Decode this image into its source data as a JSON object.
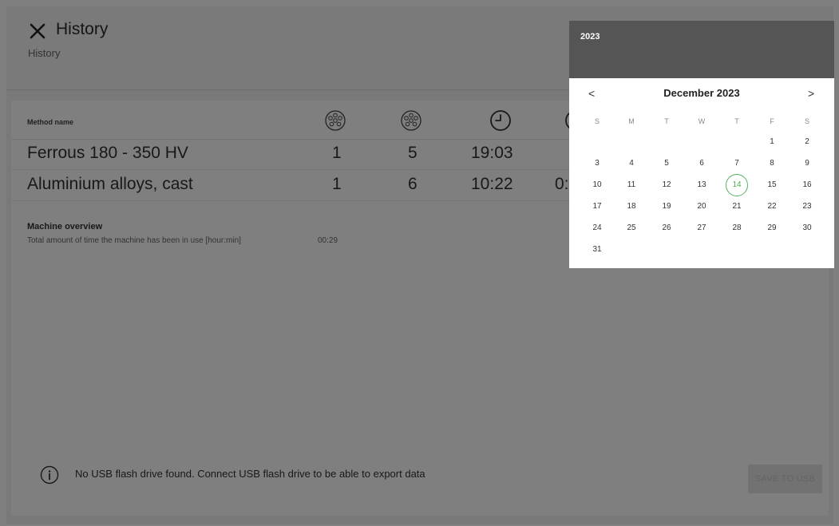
{
  "header": {
    "title": "History",
    "subtitle": "History"
  },
  "table": {
    "columns": {
      "method_name": "Method name"
    },
    "header_icons": [
      "disc-specimen-icon",
      "disc-specimen-icon",
      "clock-icon",
      "clock-icon"
    ],
    "rows": [
      {
        "name": "Ferrous 180 - 350 HV",
        "col1": "1",
        "col2": "5",
        "col3": "19:03"
      },
      {
        "name": "Aluminium alloys, cast",
        "col1": "1",
        "col2": "6",
        "col3": "10:22",
        "col4": "0:"
      }
    ]
  },
  "overview": {
    "title": "Machine overview",
    "label": "Total amount of time the machine has been in use [hour:min]",
    "value": "00:29"
  },
  "usb": {
    "message": "No USB flash drive found. Connect USB flash drive to be able to export data",
    "icon": "info-icon"
  },
  "save_button": {
    "label": "SAVE TO USB"
  },
  "datepicker": {
    "year": "2023",
    "month_label": "December 2023",
    "prev": "<",
    "next": ">",
    "weekdays": [
      "S",
      "M",
      "T",
      "W",
      "T",
      "F",
      "S"
    ],
    "days": [
      "1",
      "2",
      "3",
      "4",
      "5",
      "6",
      "7",
      "8",
      "9",
      "10",
      "11",
      "12",
      "13",
      "14",
      "15",
      "16",
      "17",
      "18",
      "19",
      "20",
      "21",
      "22",
      "23",
      "24",
      "25",
      "26",
      "27",
      "28",
      "29",
      "30",
      "31"
    ],
    "first_weekday_index": 5,
    "selected_day": "14",
    "accent": "#4caf50",
    "header_color": "#555555"
  }
}
